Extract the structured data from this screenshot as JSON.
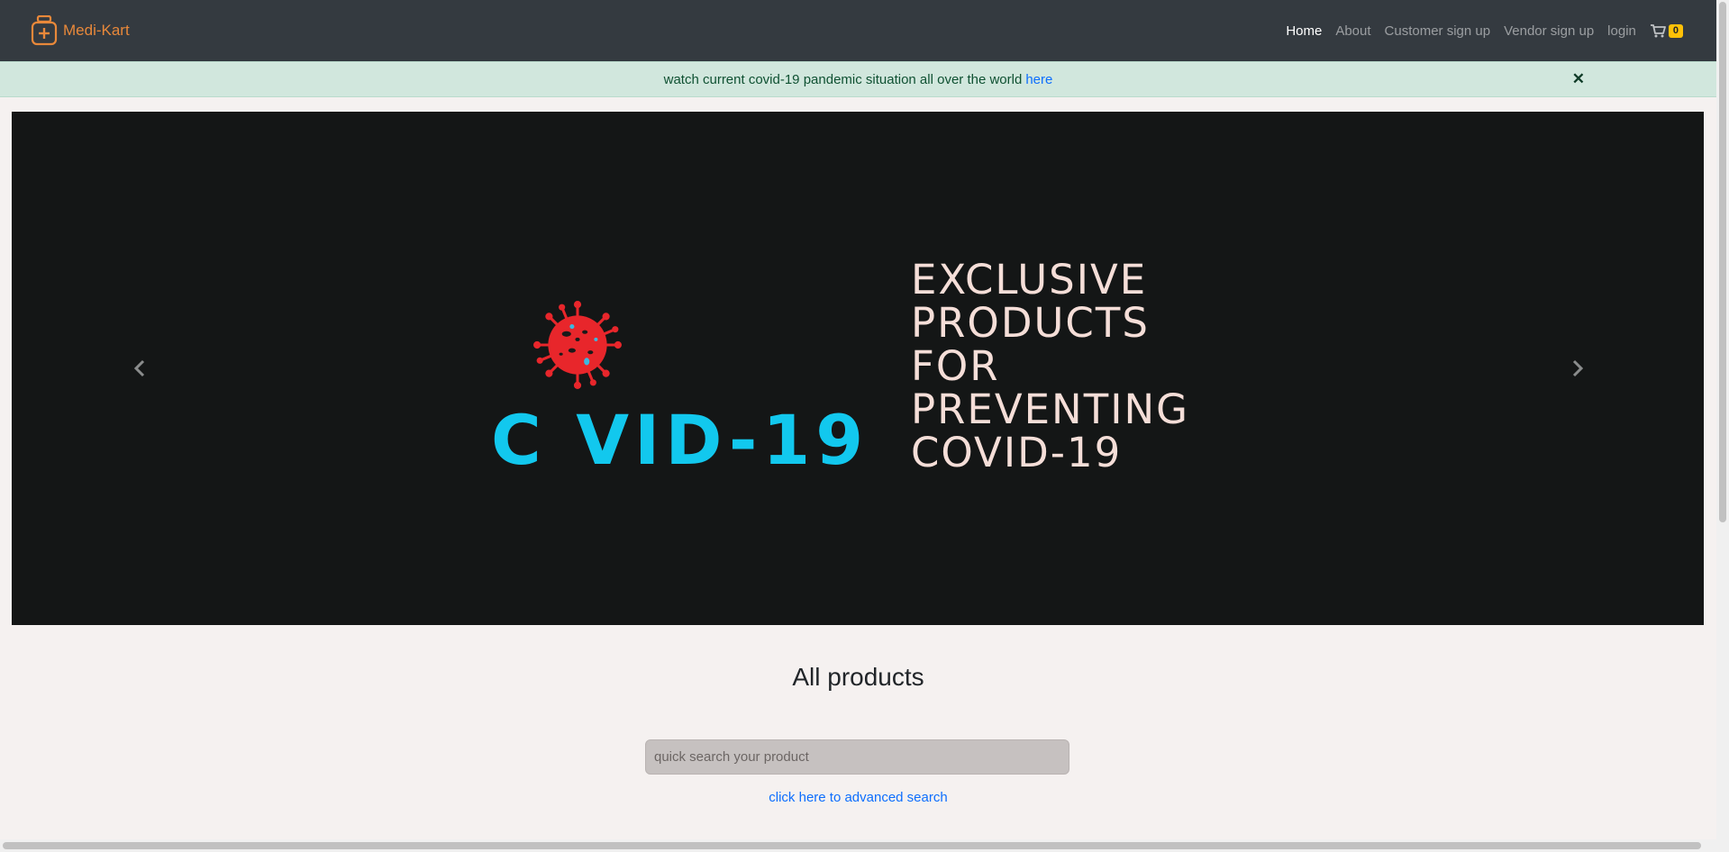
{
  "navbar": {
    "brand": "Medi-Kart",
    "links": [
      {
        "label": "Home",
        "active": true
      },
      {
        "label": "About"
      },
      {
        "label": "Customer sign up"
      },
      {
        "label": "Vendor sign up"
      },
      {
        "label": "login"
      }
    ],
    "cart_count": "0"
  },
  "alert": {
    "text": "watch current covid-19 pandemic situation all over the world",
    "link_label": "here",
    "close_label": "✕"
  },
  "carousel": {
    "slide": {
      "covid_word": "C  VID-19",
      "lines": [
        "EXCLUSIVE",
        "PRODUCTS",
        "FOR",
        "PREVENTING",
        "COVID-19"
      ]
    },
    "prev_icon": "chevron-left-icon",
    "next_icon": "chevron-right-icon"
  },
  "products": {
    "title": "All products",
    "search_placeholder": "quick search your product",
    "advanced_link": "click here to advanced search"
  },
  "colors": {
    "navbar_bg": "#343a40",
    "brand": "#e8883a",
    "alert_bg": "#d1e7dd",
    "link": "#0d6efd",
    "covid_cyan": "#12c8ee",
    "virus_red": "#e8262b",
    "badge": "#ffc107"
  }
}
